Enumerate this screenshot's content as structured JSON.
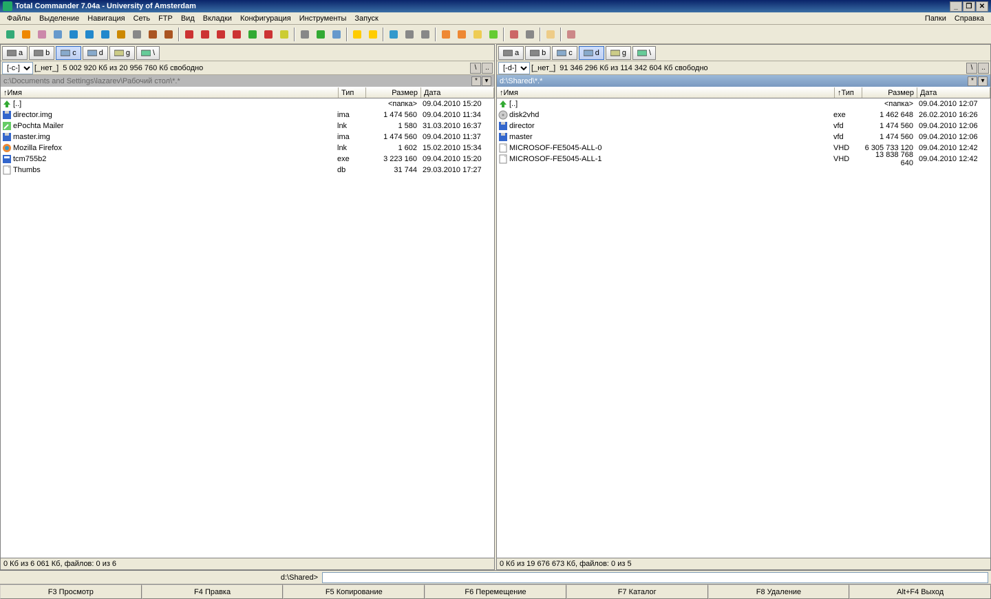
{
  "title": "Total Commander 7.04a - University of Amsterdam",
  "menu": {
    "items": [
      "Файлы",
      "Выделение",
      "Навигация",
      "Сеть",
      "FTP",
      "Вид",
      "Вкладки",
      "Конфигурация",
      "Инструменты",
      "Запуск"
    ],
    "right": [
      "Папки",
      "Справка"
    ]
  },
  "drives": [
    "a",
    "b",
    "c",
    "d",
    "g"
  ],
  "left": {
    "selected_drive": "c",
    "drive_combo": "[-c-]",
    "vol_label": "[_нет_]",
    "free_label": "5 002 920 Кб из 20 956 760 Кб свободно",
    "path": "c:\\Documents and Settings\\lazarev\\Рабочий стол\\*.*",
    "columns": {
      "name": "↑Имя",
      "type": "Тип",
      "size": "Размер",
      "date": "Дата"
    },
    "rows": [
      {
        "icon": "up",
        "name": "[..]",
        "type": "",
        "size": "<папка>",
        "date": "09.04.2010 15:20"
      },
      {
        "icon": "floppy",
        "name": "director.img",
        "type": "ima",
        "size": "1 474 560",
        "date": "09.04.2010 11:34"
      },
      {
        "icon": "shortcut",
        "name": "ePochta Mailer",
        "type": "lnk",
        "size": "1 580",
        "date": "31.03.2010 16:37"
      },
      {
        "icon": "floppy",
        "name": "master.img",
        "type": "ima",
        "size": "1 474 560",
        "date": "09.04.2010 11:37"
      },
      {
        "icon": "firefox",
        "name": "Mozilla Firefox",
        "type": "lnk",
        "size": "1 602",
        "date": "15.02.2010 15:34"
      },
      {
        "icon": "exe",
        "name": "tcm755b2",
        "type": "exe",
        "size": "3 223 160",
        "date": "09.04.2010 15:20"
      },
      {
        "icon": "file",
        "name": "Thumbs",
        "type": "db",
        "size": "31 744",
        "date": "29.03.2010 17:27"
      }
    ],
    "status": "0 Кб из 6 061 Кб, файлов: 0 из 6"
  },
  "right": {
    "selected_drive": "d",
    "drive_combo": "[-d-]",
    "vol_label": "[_нет_]",
    "free_label": "91 346 296 Кб из 114 342 604 Кб свободно",
    "path": "d:\\Shared\\*.*",
    "columns": {
      "name": "↑Имя",
      "type": "↑Тип",
      "size": "Размер",
      "date": "Дата"
    },
    "rows": [
      {
        "icon": "up",
        "name": "[..]",
        "type": "",
        "size": "<папка>",
        "date": "09.04.2010 12:07"
      },
      {
        "icon": "disk",
        "name": "disk2vhd",
        "type": "exe",
        "size": "1 462 648",
        "date": "26.02.2010 16:26"
      },
      {
        "icon": "floppy",
        "name": "director",
        "type": "vfd",
        "size": "1 474 560",
        "date": "09.04.2010 12:06"
      },
      {
        "icon": "floppy",
        "name": "master",
        "type": "vfd",
        "size": "1 474 560",
        "date": "09.04.2010 12:06"
      },
      {
        "icon": "file",
        "name": "MICROSOF-FE5045-ALL-0",
        "type": "VHD",
        "size": "6 305 733 120",
        "date": "09.04.2010 12:42"
      },
      {
        "icon": "file",
        "name": "MICROSOF-FE5045-ALL-1",
        "type": "VHD",
        "size": "13 838 768 640",
        "date": "09.04.2010 12:42"
      }
    ],
    "status": "0 Кб из 19 676 673 Кб, файлов: 0 из 5"
  },
  "cmdpath": "d:\\Shared>",
  "fn": [
    "F3 Просмотр",
    "F4 Правка",
    "F5 Копирование",
    "F6 Перемещение",
    "F7 Каталог",
    "F8 Удаление",
    "Alt+F4 Выход"
  ],
  "toolbar_icons": [
    "refresh",
    "gear",
    "wand",
    "copy-names",
    "arrow-left",
    "arrow-right",
    "swap",
    "link",
    "7z",
    "pack",
    "unpack",
    "sep",
    "mark-up",
    "mark-down",
    "mark-right",
    "mark-left",
    "plus",
    "minus",
    "star",
    "sep",
    "search",
    "tree",
    "fullscreen",
    "sep",
    "tc",
    "folder",
    "sep",
    "globe",
    "cpanel",
    "mycomp",
    "sep",
    "app1",
    "app2",
    "app3",
    "app4",
    "sep",
    "book",
    "split",
    "sep",
    "notepad",
    "sep",
    "hammer"
  ],
  "drive_icons": {
    "a": "floppy-drive",
    "b": "floppy-drive",
    "c": "hdd",
    "d": "hdd",
    "g": "cd",
    "net": "network"
  }
}
